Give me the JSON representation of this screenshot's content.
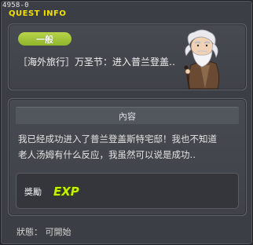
{
  "window": {
    "quest_id": "4958-0",
    "title": "QUEST INFO"
  },
  "quest": {
    "category": "一般",
    "name": "［海外旅行］万圣节：进入普兰登盖‥",
    "npc_icon": "old-man-npc-portrait"
  },
  "content": {
    "header": "內容",
    "line1": "我已经成功进入了普兰登盖斯特宅邸！我也不知道",
    "line2": "老人汤姆有什么反应，我虽然可以说是成功‥"
  },
  "reward": {
    "label": "獎勵",
    "icon": "exp-icon",
    "exp_text": "EXP"
  },
  "status": {
    "text": "狀態： 可開始"
  },
  "colors": {
    "title": "#f2e000",
    "badge": "#9cc234",
    "exp": "#c6f000"
  }
}
